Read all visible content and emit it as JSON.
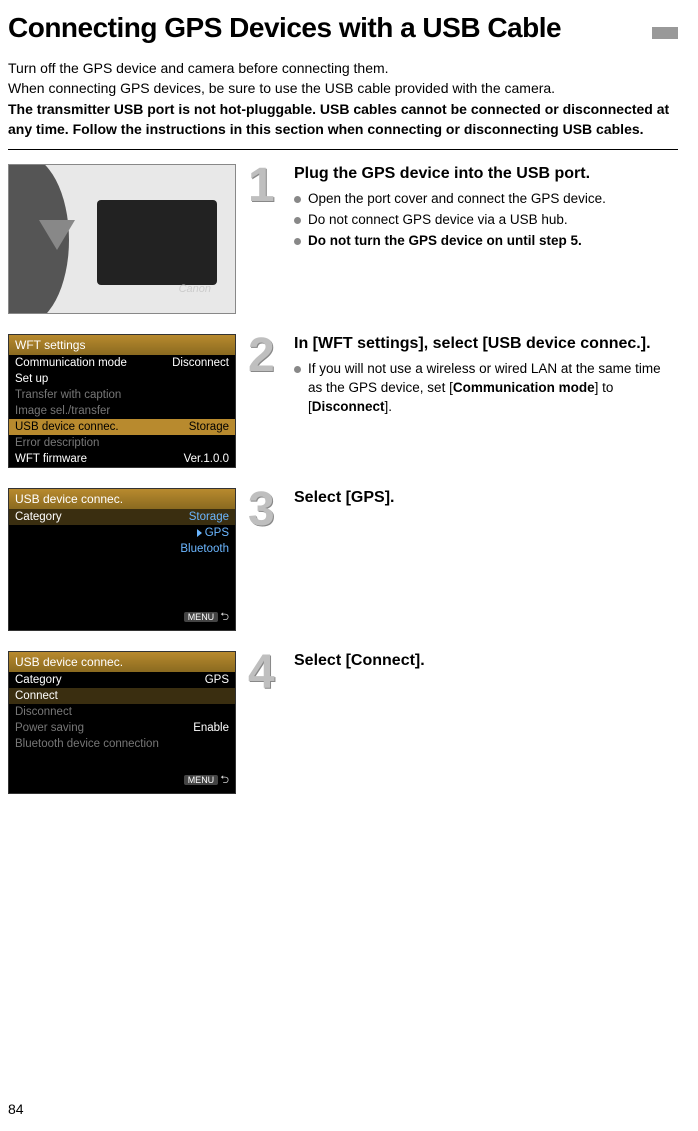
{
  "title": "Connecting GPS Devices with a USB Cable",
  "intro": {
    "line1": "Turn off the GPS device and camera before connecting them.",
    "line2": "When connecting GPS devices, be sure to use the USB cable provided with the camera.",
    "bold": "The transmitter USB port is not hot-pluggable. USB cables cannot be connected or disconnected at any time. Follow the instructions in this section when connecting or disconnecting USB cables."
  },
  "camera_brand": "Canon",
  "steps": [
    {
      "num": "1",
      "heading": "Plug the GPS device into the USB port.",
      "bullets": [
        {
          "text": "Open the port cover and connect the GPS device.",
          "bold": false
        },
        {
          "text": "Do not connect GPS device via a USB hub.",
          "bold": false
        },
        {
          "text": "Do not turn the GPS device on until step 5.",
          "bold": true
        }
      ]
    },
    {
      "num": "2",
      "heading": "In [WFT settings], select [USB device connec.].",
      "bullets": [
        {
          "text_pre": "If you will not use a wireless or wired LAN at the same time as the GPS device, set [",
          "b1": "Communication mode",
          "mid": "] to [",
          "b2": "Disconnect",
          "post": "]."
        }
      ]
    },
    {
      "num": "3",
      "heading": "Select [GPS].",
      "bullets": []
    },
    {
      "num": "4",
      "heading": "Select [Connect].",
      "bullets": []
    }
  ],
  "menu2": {
    "title": "WFT settings",
    "rows": [
      {
        "label": "Communication mode",
        "val": "Disconnect",
        "dim": false
      },
      {
        "label": "Set up",
        "val": "",
        "dim": false
      },
      {
        "label": "Transfer with caption",
        "val": "",
        "dim": true
      },
      {
        "label": "Image sel./transfer",
        "val": "",
        "dim": true
      },
      {
        "label": "USB device connec.",
        "val": "Storage",
        "dim": false,
        "hl": true
      },
      {
        "label": "Error description",
        "val": "",
        "dim": true
      },
      {
        "label": "WFT firmware",
        "val": "Ver.1.0.0",
        "dim": false
      }
    ]
  },
  "menu3": {
    "title": "USB device connec.",
    "category_label": "Category",
    "options": [
      "Storage",
      "GPS",
      "Bluetooth"
    ],
    "selected": "GPS",
    "footer": "MENU"
  },
  "menu4": {
    "title": "USB device connec.",
    "rows": [
      {
        "label": "Category",
        "val": "GPS",
        "dim": false
      },
      {
        "label": "Connect",
        "val": "",
        "dim": false,
        "hl": true
      },
      {
        "label": "Disconnect",
        "val": "",
        "dim": true
      },
      {
        "label": "Power saving",
        "val": "Enable",
        "dim": true
      },
      {
        "label": "Bluetooth device connection",
        "val": "",
        "dim": true
      }
    ],
    "footer": "MENU"
  },
  "page_number": "84"
}
